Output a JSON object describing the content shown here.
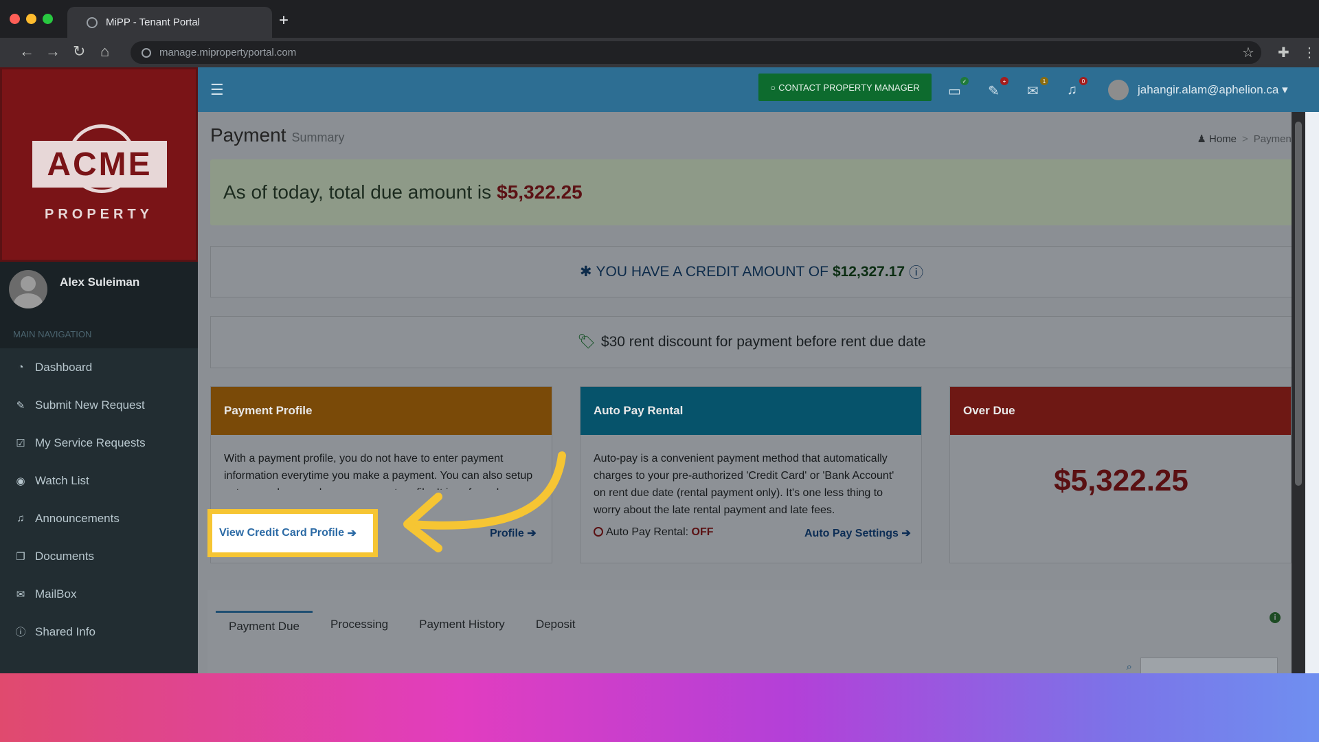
{
  "browser": {
    "tab_title": "MiPP - Tenant Portal",
    "url": "manage.mipropertyportal.com"
  },
  "sidebar": {
    "logo_text": "ACME",
    "logo_sub": "PROPERTY",
    "user_name": "Alex Suleiman",
    "nav_header": "MAIN NAVIGATION",
    "items": [
      {
        "label": "Dashboard",
        "icon": "dashboard-icon"
      },
      {
        "label": "Submit New Request",
        "icon": "wrench-icon"
      },
      {
        "label": "My Service Requests",
        "icon": "checkbox-icon"
      },
      {
        "label": "Watch List",
        "icon": "eye-icon"
      },
      {
        "label": "Announcements",
        "icon": "bell-icon"
      },
      {
        "label": "Documents",
        "icon": "documents-icon"
      },
      {
        "label": "MailBox",
        "icon": "envelope-icon"
      },
      {
        "label": "Shared Info",
        "icon": "info-icon"
      }
    ]
  },
  "header": {
    "contact_button": "CONTACT PROPERTY MANAGER",
    "mail_count": "1",
    "notif_count": "0",
    "user_email": "jahangir.alam@aphelion.ca"
  },
  "page": {
    "title": "Payment",
    "subtitle": "Summary",
    "breadcrumb": [
      "Home",
      "Payment"
    ]
  },
  "summary": {
    "due_text": "As of today, total due amount is",
    "due_amount": "$5,322.25",
    "credit_text": "YOU HAVE A CREDIT AMOUNT OF",
    "credit_amount": "$12,327.17",
    "discount_text": "$30 rent discount for payment before rent due date"
  },
  "cards": {
    "payment_profile": {
      "title": "Payment Profile",
      "body": "With a payment profile, you do not have to enter payment information everytime you make a payment. You can also setup auto pay when you have a payment profile. It is safe and secure.",
      "link_partial": "Profile",
      "highlight_link": "View Credit Card Profile"
    },
    "auto_pay": {
      "title": "Auto Pay Rental",
      "body": "Auto-pay is a convenient payment method that automatically charges to your pre-authorized 'Credit Card' or 'Bank Account' on rent due date (rental payment only). It's one less thing to worry about the late rental payment and late fees.",
      "status_label": "Auto Pay Rental:",
      "status_value": "OFF",
      "settings_link": "Auto Pay Settings"
    },
    "over_due": {
      "title": "Over Due",
      "amount": "$5,322.25"
    }
  },
  "tabs": [
    "Payment Due",
    "Processing",
    "Payment History",
    "Deposit"
  ],
  "colors": {
    "profile_header": "#7a4a08",
    "autopay_header": "#06536b",
    "overdue_header": "#6e1814",
    "highlight": "#f6c533"
  }
}
